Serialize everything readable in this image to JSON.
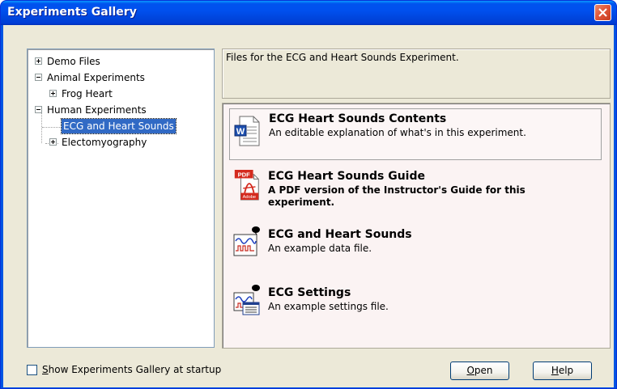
{
  "window": {
    "title": "Experiments Gallery"
  },
  "tree": {
    "items": [
      {
        "label": "Demo Files",
        "expander": "plus"
      },
      {
        "label": "Animal Experiments",
        "expander": "minus"
      },
      {
        "label": "Frog Heart",
        "expander": "plus"
      },
      {
        "label": "Human Experiments",
        "expander": "minus"
      },
      {
        "label": "ECG and Heart Sounds",
        "expander": "none",
        "selected": true
      },
      {
        "label": "Electomyography",
        "expander": "plus"
      }
    ]
  },
  "description": {
    "text": "Files for the ECG and Heart Sounds Experiment."
  },
  "files": [
    {
      "title": "ECG Heart Sounds Contents",
      "desc": "An editable explanation of what's in this experiment.",
      "icon": "word-document-icon",
      "selected": true
    },
    {
      "title": "ECG Heart Sounds Guide",
      "desc": "A PDF version of the Instructor's Guide for this experiment.",
      "icon": "pdf-document-icon",
      "bold_desc": true
    },
    {
      "title": "ECG and Heart Sounds",
      "desc": "An example data file.",
      "icon": "data-file-icon"
    },
    {
      "title": "ECG Settings",
      "desc": "An example settings file.",
      "icon": "settings-file-icon"
    }
  ],
  "footer": {
    "startup_checkbox": {
      "label_first": "S",
      "label_rest": "how Experiments Gallery at startup",
      "checked": false
    },
    "open_button": {
      "first": "O",
      "rest": "pen"
    },
    "help_button": {
      "first": "H",
      "rest": "elp"
    }
  },
  "colors": {
    "titlebar": "#0054e3",
    "selection": "#316ac5",
    "dialog_bg": "#ece9d8",
    "files_bg": "#fbf3f3"
  }
}
